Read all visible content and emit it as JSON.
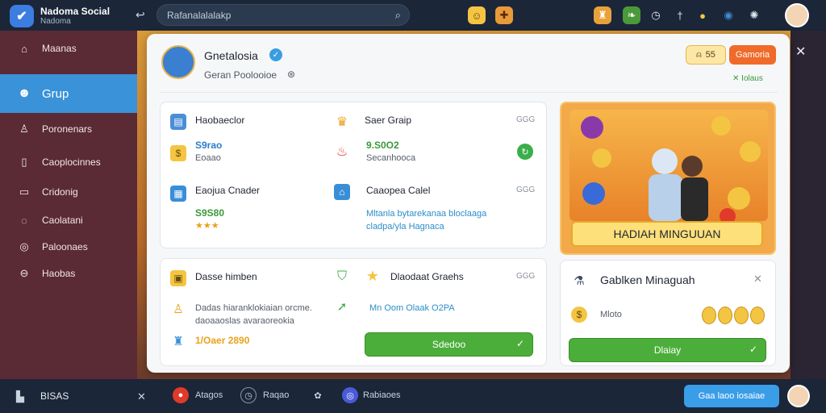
{
  "app": {
    "title": "Nadoma Social",
    "subtitle": "Nadoma"
  },
  "search": {
    "placeholder": "Rafanalalalakp"
  },
  "sidebar": {
    "items": [
      {
        "label": "Maanas",
        "icon": "home-icon"
      },
      {
        "label": "Grup",
        "icon": "group-icon"
      },
      {
        "label": "Poronenars",
        "icon": "profile-icon"
      },
      {
        "label": "Caoplocinnes",
        "icon": "shop-icon"
      },
      {
        "label": "Cridonig",
        "icon": "calendar-icon"
      },
      {
        "label": "Caolatani",
        "icon": "chat-icon"
      },
      {
        "label": "Paloonaes",
        "icon": "settings-icon"
      },
      {
        "label": "Haobas",
        "icon": "help-icon"
      }
    ]
  },
  "header": {
    "name": "Gnetalosia",
    "subtitle": "Geran Poolooioe",
    "coins": "55",
    "action_button": "Gamoria",
    "small_link": "Iolaus"
  },
  "panel1": {
    "r1_label": "Haobaeclor",
    "r1_value": "S9rao",
    "r1_sub": "Eoaao",
    "r2_label": "Eaojua Cnader",
    "r2_value": "S9S80",
    "r2_stars": "★★★",
    "c2_r1_label": "Saer Graip",
    "c2_r1_tiny": "GGG",
    "c2_r1_value": "9.S0O2",
    "c2_r1_sub": "Secanhooca",
    "c2_r2_label": "Caaopea Calel",
    "c2_r2_tiny": "GGG",
    "c2_r2_text": "Mltanla bytarekanaa bloclaaga cladpa/yla Hagnaca"
  },
  "panel2": {
    "r1_label": "Dasse himben",
    "r1_text": "Dadas hiaranklokiaian orcme. daoaaoslas avaraoreokia",
    "r3_value": "1/Oaer 2890",
    "c2_label": "Dlaodaat Graehs",
    "c2_tiny": "GGG",
    "c2_text": "Mn Oom  Olaak  O2PA",
    "button": "Sdedoo"
  },
  "reward": {
    "title": "HADIAH MINGUUAN"
  },
  "weekly": {
    "title": "Gablken Minaguah",
    "row_label": "Mloto",
    "button": "Dlaiay"
  },
  "bottombar": {
    "left_label": "BISAS",
    "items": [
      "Atagos",
      "Raqao",
      "Rabiaoes"
    ],
    "button": "Gaa laoo iosaiae"
  }
}
